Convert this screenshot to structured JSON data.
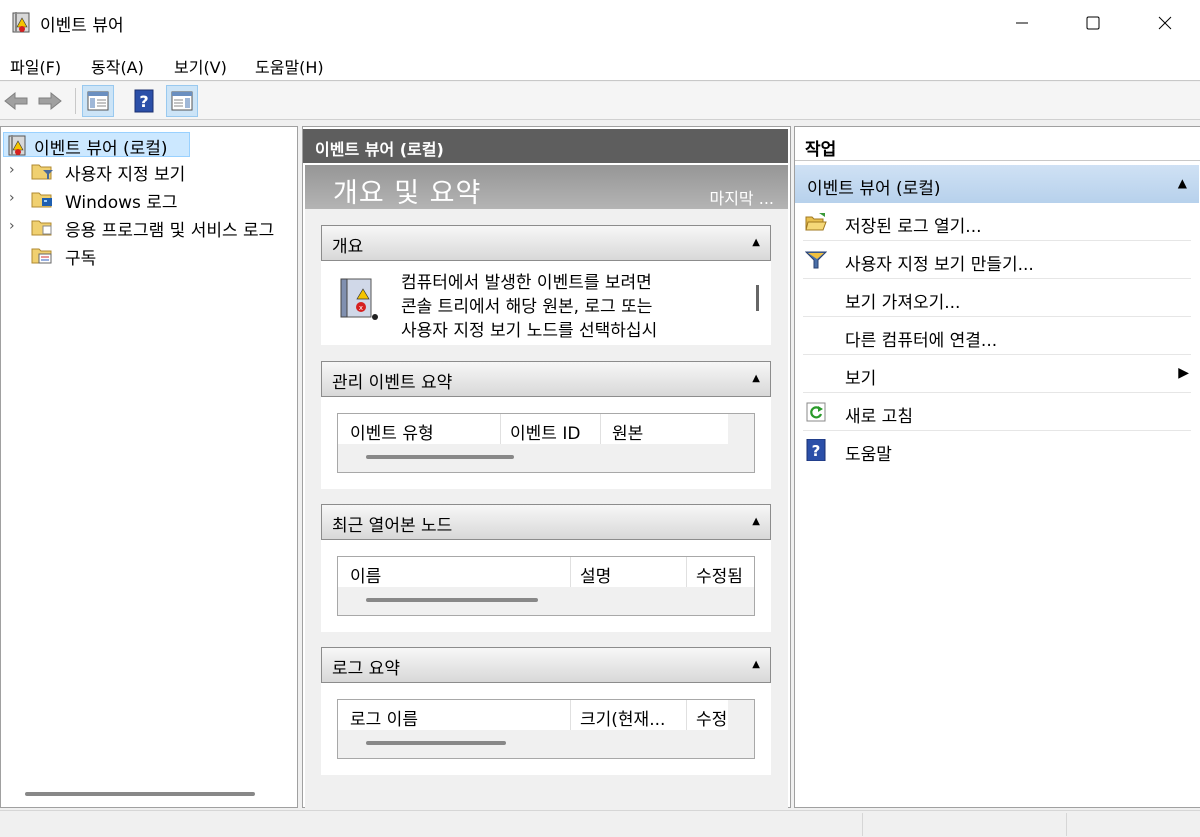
{
  "window": {
    "title": "이벤트 뷰어"
  },
  "menubar": {
    "items": [
      "파일(F)",
      "동작(A)",
      "보기(V)",
      "도움말(H)"
    ]
  },
  "toolbar": {
    "buttons": [
      "back-icon",
      "forward-icon",
      "show-hide-console-tree-icon",
      "help-icon",
      "show-hide-action-pane-icon"
    ]
  },
  "tree": {
    "root": "이벤트 뷰어 (로컬)",
    "nodes": [
      "사용자 지정 보기",
      "Windows 로그",
      "응용 프로그램 및 서비스 로그",
      "구독"
    ]
  },
  "middle": {
    "header": "이벤트 뷰어 (로컬)",
    "banner_title": "개요 및 요약",
    "banner_right": "마지막 ...",
    "overview": {
      "title": "개요",
      "lines": [
        "컴퓨터에서 발생한 이벤트를 보려면",
        "콘솔 트리에서 해당 원본, 로그 또는",
        "사용자 지정 보기 노드를 선택하십시"
      ]
    },
    "admin_summary": {
      "title": "관리 이벤트 요약",
      "columns": [
        "이벤트 유형",
        "이벤트 ID",
        "원본"
      ]
    },
    "recent_nodes": {
      "title": "최근 열어본 노드",
      "columns": [
        "이름",
        "설명",
        "수정됨"
      ]
    },
    "log_summary": {
      "title": "로그 요약",
      "columns": [
        "로그 이름",
        "크기(현재...",
        "수정"
      ]
    }
  },
  "actions": {
    "title": "작업",
    "group": "이벤트 뷰어 (로컬)",
    "items": [
      "저장된 로그 열기...",
      "사용자 지정 보기 만들기...",
      "보기 가져오기...",
      "다른 컴퓨터에 연결...",
      "보기",
      "새로 고침",
      "도움말"
    ]
  },
  "colors": {
    "selection": "#cce8ff",
    "action_group": "#c4daf1",
    "pane_header": "#5e5e5e"
  }
}
